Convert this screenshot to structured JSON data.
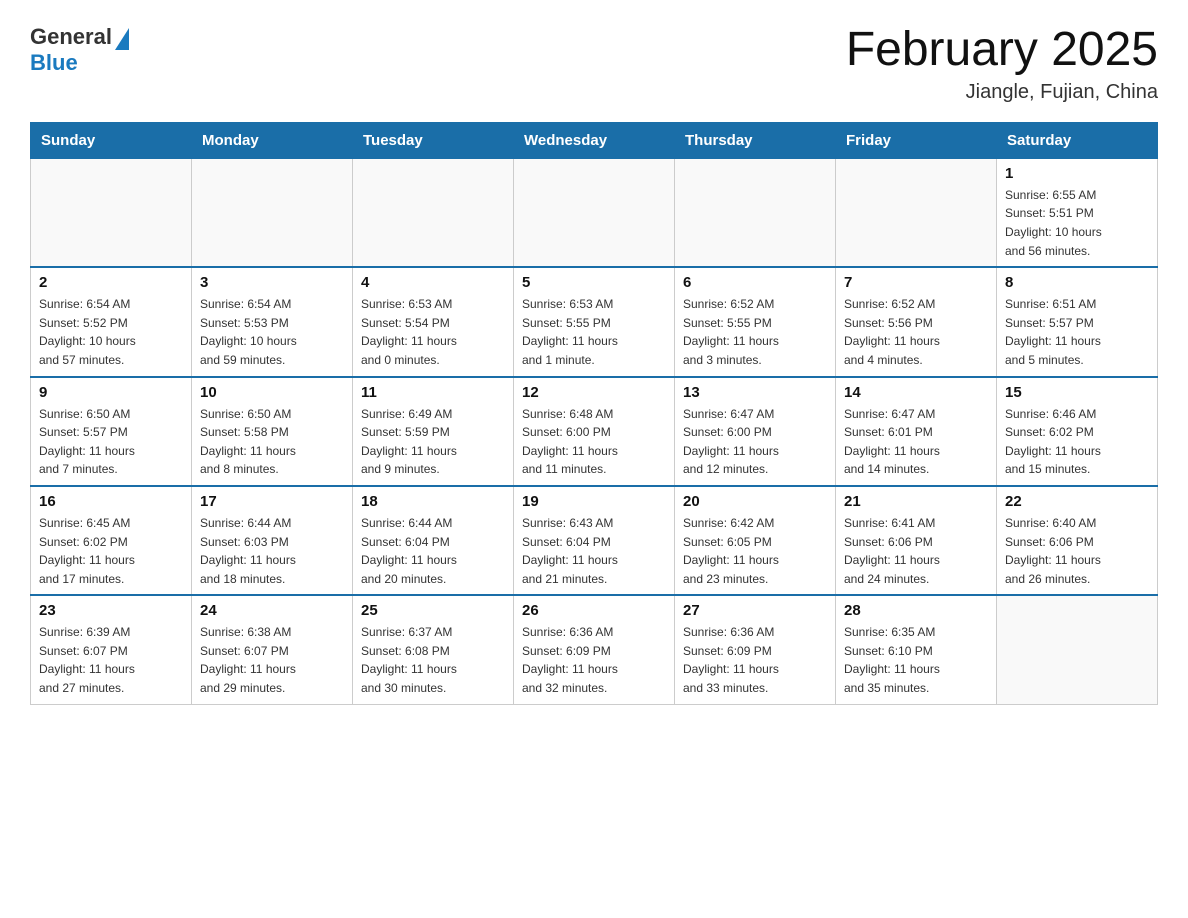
{
  "header": {
    "logo_general": "General",
    "logo_blue": "Blue",
    "title": "February 2025",
    "location": "Jiangle, Fujian, China"
  },
  "days_of_week": [
    "Sunday",
    "Monday",
    "Tuesday",
    "Wednesday",
    "Thursday",
    "Friday",
    "Saturday"
  ],
  "weeks": [
    [
      {
        "day": "",
        "info": ""
      },
      {
        "day": "",
        "info": ""
      },
      {
        "day": "",
        "info": ""
      },
      {
        "day": "",
        "info": ""
      },
      {
        "day": "",
        "info": ""
      },
      {
        "day": "",
        "info": ""
      },
      {
        "day": "1",
        "info": "Sunrise: 6:55 AM\nSunset: 5:51 PM\nDaylight: 10 hours\nand 56 minutes."
      }
    ],
    [
      {
        "day": "2",
        "info": "Sunrise: 6:54 AM\nSunset: 5:52 PM\nDaylight: 10 hours\nand 57 minutes."
      },
      {
        "day": "3",
        "info": "Sunrise: 6:54 AM\nSunset: 5:53 PM\nDaylight: 10 hours\nand 59 minutes."
      },
      {
        "day": "4",
        "info": "Sunrise: 6:53 AM\nSunset: 5:54 PM\nDaylight: 11 hours\nand 0 minutes."
      },
      {
        "day": "5",
        "info": "Sunrise: 6:53 AM\nSunset: 5:55 PM\nDaylight: 11 hours\nand 1 minute."
      },
      {
        "day": "6",
        "info": "Sunrise: 6:52 AM\nSunset: 5:55 PM\nDaylight: 11 hours\nand 3 minutes."
      },
      {
        "day": "7",
        "info": "Sunrise: 6:52 AM\nSunset: 5:56 PM\nDaylight: 11 hours\nand 4 minutes."
      },
      {
        "day": "8",
        "info": "Sunrise: 6:51 AM\nSunset: 5:57 PM\nDaylight: 11 hours\nand 5 minutes."
      }
    ],
    [
      {
        "day": "9",
        "info": "Sunrise: 6:50 AM\nSunset: 5:57 PM\nDaylight: 11 hours\nand 7 minutes."
      },
      {
        "day": "10",
        "info": "Sunrise: 6:50 AM\nSunset: 5:58 PM\nDaylight: 11 hours\nand 8 minutes."
      },
      {
        "day": "11",
        "info": "Sunrise: 6:49 AM\nSunset: 5:59 PM\nDaylight: 11 hours\nand 9 minutes."
      },
      {
        "day": "12",
        "info": "Sunrise: 6:48 AM\nSunset: 6:00 PM\nDaylight: 11 hours\nand 11 minutes."
      },
      {
        "day": "13",
        "info": "Sunrise: 6:47 AM\nSunset: 6:00 PM\nDaylight: 11 hours\nand 12 minutes."
      },
      {
        "day": "14",
        "info": "Sunrise: 6:47 AM\nSunset: 6:01 PM\nDaylight: 11 hours\nand 14 minutes."
      },
      {
        "day": "15",
        "info": "Sunrise: 6:46 AM\nSunset: 6:02 PM\nDaylight: 11 hours\nand 15 minutes."
      }
    ],
    [
      {
        "day": "16",
        "info": "Sunrise: 6:45 AM\nSunset: 6:02 PM\nDaylight: 11 hours\nand 17 minutes."
      },
      {
        "day": "17",
        "info": "Sunrise: 6:44 AM\nSunset: 6:03 PM\nDaylight: 11 hours\nand 18 minutes."
      },
      {
        "day": "18",
        "info": "Sunrise: 6:44 AM\nSunset: 6:04 PM\nDaylight: 11 hours\nand 20 minutes."
      },
      {
        "day": "19",
        "info": "Sunrise: 6:43 AM\nSunset: 6:04 PM\nDaylight: 11 hours\nand 21 minutes."
      },
      {
        "day": "20",
        "info": "Sunrise: 6:42 AM\nSunset: 6:05 PM\nDaylight: 11 hours\nand 23 minutes."
      },
      {
        "day": "21",
        "info": "Sunrise: 6:41 AM\nSunset: 6:06 PM\nDaylight: 11 hours\nand 24 minutes."
      },
      {
        "day": "22",
        "info": "Sunrise: 6:40 AM\nSunset: 6:06 PM\nDaylight: 11 hours\nand 26 minutes."
      }
    ],
    [
      {
        "day": "23",
        "info": "Sunrise: 6:39 AM\nSunset: 6:07 PM\nDaylight: 11 hours\nand 27 minutes."
      },
      {
        "day": "24",
        "info": "Sunrise: 6:38 AM\nSunset: 6:07 PM\nDaylight: 11 hours\nand 29 minutes."
      },
      {
        "day": "25",
        "info": "Sunrise: 6:37 AM\nSunset: 6:08 PM\nDaylight: 11 hours\nand 30 minutes."
      },
      {
        "day": "26",
        "info": "Sunrise: 6:36 AM\nSunset: 6:09 PM\nDaylight: 11 hours\nand 32 minutes."
      },
      {
        "day": "27",
        "info": "Sunrise: 6:36 AM\nSunset: 6:09 PM\nDaylight: 11 hours\nand 33 minutes."
      },
      {
        "day": "28",
        "info": "Sunrise: 6:35 AM\nSunset: 6:10 PM\nDaylight: 11 hours\nand 35 minutes."
      },
      {
        "day": "",
        "info": ""
      }
    ]
  ]
}
